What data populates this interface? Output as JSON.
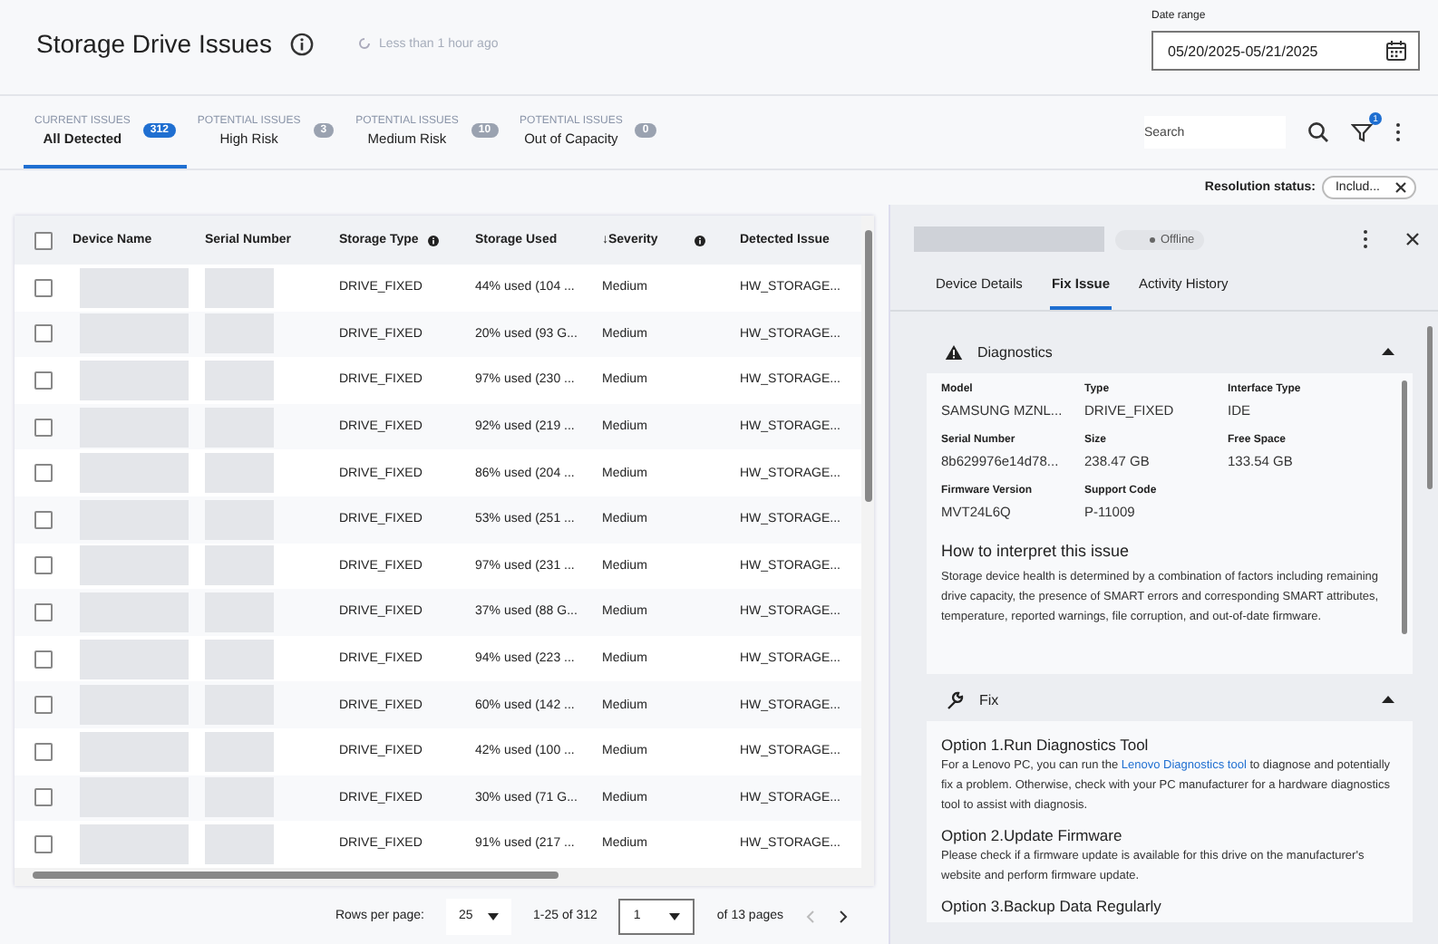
{
  "header": {
    "title": "Storage Drive Issues",
    "updated": "Less than 1 hour ago",
    "date_range": {
      "label": "Date range",
      "value": "05/20/2025-05/21/2025"
    }
  },
  "tabs": [
    {
      "category": "CURRENT ISSUES",
      "label": "All Detected",
      "count": "312",
      "selected": true
    },
    {
      "category": "POTENTIAL ISSUES",
      "label": "High Risk",
      "count": "3",
      "selected": false
    },
    {
      "category": "POTENTIAL ISSUES",
      "label": "Medium Risk",
      "count": "10",
      "selected": false
    },
    {
      "category": "POTENTIAL ISSUES",
      "label": "Out of Capacity",
      "count": "0",
      "selected": false
    }
  ],
  "toolbar": {
    "search": {
      "placeholder": "Search"
    },
    "filter_count": "1"
  },
  "resolution_status": {
    "label": "Resolution status:",
    "value": "Includ..."
  },
  "table": {
    "select_all_checked": false,
    "columns": [
      {
        "label": "Device Name",
        "info": false
      },
      {
        "label": "Serial Number",
        "info": false
      },
      {
        "label": "Storage Type",
        "info": true
      },
      {
        "label": "Storage Used",
        "info": false
      },
      {
        "label": "↓Severity",
        "info": true
      },
      {
        "label": "Detected Issue",
        "info": false
      }
    ],
    "rows": [
      {
        "checked": false,
        "storage_type": "DRIVE_FIXED",
        "storage_used": "44% used (104 ...",
        "severity": "Medium",
        "detected_issue": "HW_STORAGE..."
      },
      {
        "checked": false,
        "storage_type": "DRIVE_FIXED",
        "storage_used": "20% used (93 G...",
        "severity": "Medium",
        "detected_issue": "HW_STORAGE..."
      },
      {
        "checked": false,
        "storage_type": "DRIVE_FIXED",
        "storage_used": "97% used (230 ...",
        "severity": "Medium",
        "detected_issue": "HW_STORAGE..."
      },
      {
        "checked": false,
        "storage_type": "DRIVE_FIXED",
        "storage_used": "92% used (219 ...",
        "severity": "Medium",
        "detected_issue": "HW_STORAGE..."
      },
      {
        "checked": false,
        "storage_type": "DRIVE_FIXED",
        "storage_used": "86% used (204 ...",
        "severity": "Medium",
        "detected_issue": "HW_STORAGE..."
      },
      {
        "checked": false,
        "storage_type": "DRIVE_FIXED",
        "storage_used": "53% used (251 ...",
        "severity": "Medium",
        "detected_issue": "HW_STORAGE..."
      },
      {
        "checked": false,
        "storage_type": "DRIVE_FIXED",
        "storage_used": "97% used (231 ...",
        "severity": "Medium",
        "detected_issue": "HW_STORAGE..."
      },
      {
        "checked": false,
        "storage_type": "DRIVE_FIXED",
        "storage_used": "37% used (88 G...",
        "severity": "Medium",
        "detected_issue": "HW_STORAGE..."
      },
      {
        "checked": false,
        "storage_type": "DRIVE_FIXED",
        "storage_used": "94% used (223 ...",
        "severity": "Medium",
        "detected_issue": "HW_STORAGE..."
      },
      {
        "checked": false,
        "storage_type": "DRIVE_FIXED",
        "storage_used": "60% used (142 ...",
        "severity": "Medium",
        "detected_issue": "HW_STORAGE..."
      },
      {
        "checked": false,
        "storage_type": "DRIVE_FIXED",
        "storage_used": "42% used (100 ...",
        "severity": "Medium",
        "detected_issue": "HW_STORAGE..."
      },
      {
        "checked": false,
        "storage_type": "DRIVE_FIXED",
        "storage_used": "30% used (71 G...",
        "severity": "Medium",
        "detected_issue": "HW_STORAGE..."
      },
      {
        "checked": false,
        "storage_type": "DRIVE_FIXED",
        "storage_used": "91% used (217 ...",
        "severity": "Medium",
        "detected_issue": "HW_STORAGE..."
      }
    ]
  },
  "pagination": {
    "rows_per_page_label": "Rows per page:",
    "rows_per_page": "25",
    "range": "1-25 of 312",
    "page": "1",
    "of_pages": "of 13 pages"
  },
  "detail": {
    "status": "Offline",
    "tabs": [
      {
        "label": "Device Details",
        "selected": false
      },
      {
        "label": "Fix Issue",
        "selected": true
      },
      {
        "label": "Activity History",
        "selected": false
      }
    ],
    "diagnostics": {
      "title": "Diagnostics",
      "expanded": true,
      "fields": [
        {
          "label": "Model",
          "value": "SAMSUNG MZNL..."
        },
        {
          "label": "Type",
          "value": "DRIVE_FIXED"
        },
        {
          "label": "Interface Type",
          "value": "IDE"
        },
        {
          "label": "Serial Number",
          "value": "8b629976e14d78..."
        },
        {
          "label": "Size",
          "value": "238.47 GB"
        },
        {
          "label": "Free Space",
          "value": "133.54 GB"
        },
        {
          "label": "Firmware Version",
          "value": "MVT24L6Q"
        },
        {
          "label": "Support Code",
          "value": "P-11009"
        }
      ],
      "interpret_title": "How to interpret this issue",
      "interpret_text": "Storage device health is determined by a combination of factors including remaining drive capacity, the presence of SMART errors and corresponding SMART attributes, temperature, reported warnings, file corruption, and out-of-date firmware."
    },
    "fix": {
      "title": "Fix",
      "expanded": true,
      "options": [
        {
          "title": "Option 1.Run Diagnostics Tool",
          "text_before": "For a Lenovo PC, you can run the ",
          "link": "Lenovo Diagnostics tool",
          "text_after": " to diagnose and potentially fix a problem. Otherwise, check with your PC manufacturer for a hardware diagnostics tool to assist with diagnosis."
        },
        {
          "title": "Option 2.Update Firmware",
          "text_before": "Please check if a firmware update is available for this drive on the manufacturer's website and perform firmware update."
        },
        {
          "title": "Option 3.Backup Data Regularly"
        }
      ]
    }
  }
}
